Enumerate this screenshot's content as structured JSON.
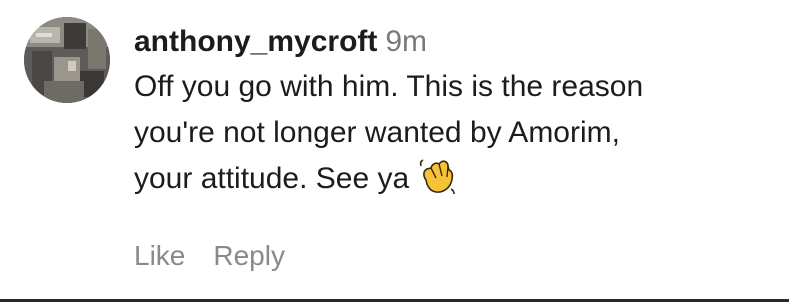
{
  "comment": {
    "username": "anthony_mycroft",
    "timestamp": "9m",
    "lines": [
      "Off you go with him. This is the reason",
      "you're not longer wanted by Amorim,",
      "your attitude. See ya"
    ],
    "emoji": "waving-hand-icon",
    "actions": {
      "like": "Like",
      "reply": "Reply"
    }
  },
  "colors": {
    "username": "#1c1c1c",
    "timestamp": "#7a7a7a",
    "actions": "#8a8a8a",
    "divider": "#2a2a2a"
  }
}
